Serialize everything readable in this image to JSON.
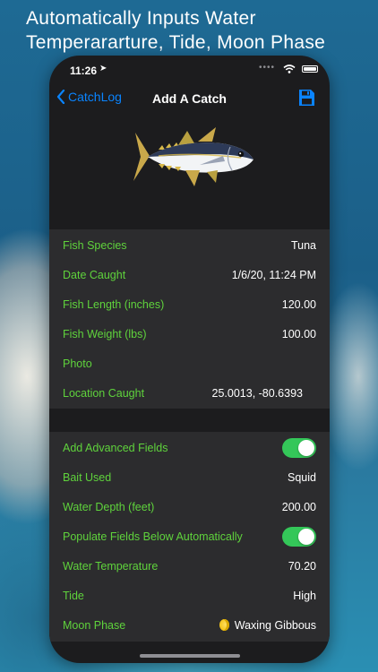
{
  "headline": "Automatically Inputs Water Temperararture, Tide, Moon Phase",
  "status_bar": {
    "time": "11:26"
  },
  "nav": {
    "back_label": "CatchLog",
    "title": "Add A Catch",
    "save_icon": "floppy-disk-icon"
  },
  "colors": {
    "accent": "#0a84ff",
    "label_green": "#5fd33c",
    "toggle_on": "#34c759",
    "cell_bg": "#2c2c2e"
  },
  "basic_fields": [
    {
      "label": "Fish Species",
      "value": "Tuna"
    },
    {
      "label": "Date Caught",
      "value": "1/6/20, 11:24 PM"
    },
    {
      "label": "Fish Length (inches)",
      "value": "120.00"
    },
    {
      "label": "Fish Weight (lbs)",
      "value": "100.00"
    },
    {
      "label": "Photo",
      "value": ""
    },
    {
      "label": "Location Caught",
      "value": "25.0013, -80.6393"
    }
  ],
  "advanced": {
    "add_advanced_label": "Add Advanced Fields",
    "add_advanced_on": true,
    "bait_label": "Bait Used",
    "bait_value": "Squid",
    "depth_label": "Water Depth (feet)",
    "depth_value": "200.00",
    "populate_label": "Populate Fields Below Automatically",
    "populate_on": true,
    "temp_label": "Water Temperature",
    "temp_value": "70.20",
    "tide_label": "Tide",
    "tide_value": "High",
    "moon_label": "Moon Phase",
    "moon_value": "Waxing Gibbous",
    "moon_icon": "waxing-gibbous-moon-icon"
  }
}
